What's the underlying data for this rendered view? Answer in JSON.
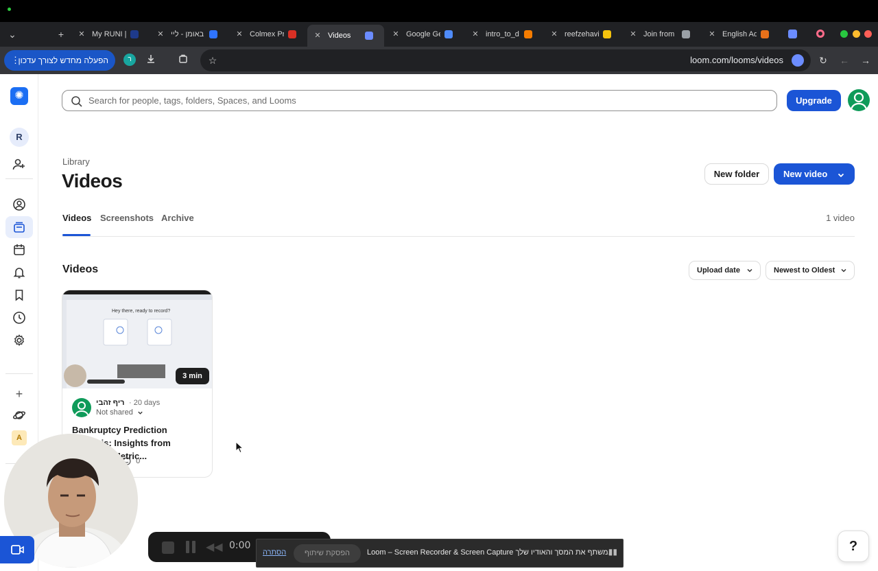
{
  "browser": {
    "tabs": [
      {
        "label": "My RUNI |",
        "fav_color": "#1e3a8a"
      },
      {
        "label": "באומן - ליי",
        "fav_color": "#2f74ff"
      },
      {
        "label": "Colmex Pr",
        "fav_color": "#d93025"
      },
      {
        "label": "Videos",
        "fav_color": "#6b8cff"
      },
      {
        "label": "Google Ge",
        "fav_color": "#4f8bf9"
      },
      {
        "label": "intro_to_d",
        "fav_color": "#f57c00"
      },
      {
        "label": "reefzehavi",
        "fav_color": "#f4c20d"
      },
      {
        "label": "Join from",
        "fav_color": "#9aa0a6"
      },
      {
        "label": "English Ad",
        "fav_color": "#e8711a"
      }
    ],
    "update_button": "הפעלה מחדש לצורך עדכון",
    "update_avatar": "ר",
    "url": "loom.com/looms/videos"
  },
  "sidebar": {
    "workspace_initial": "R",
    "workspace_alt_initial": "A"
  },
  "header": {
    "search_placeholder": "Search for people, tags, folders, Spaces, and Looms",
    "upgrade_label": "Upgrade"
  },
  "library": {
    "breadcrumb": "Library",
    "title": "Videos",
    "new_folder_label": "New folder",
    "new_video_label": "New video",
    "tabs": [
      "Videos",
      "Screenshots",
      "Archive"
    ],
    "video_count": "1 video",
    "section_title": "Videos",
    "sort_field": "Upload date",
    "sort_order": "Newest to Oldest"
  },
  "video_card": {
    "duration": "3 min",
    "author": "ריף זהבי",
    "age": "· 20 days",
    "share_status": "Not shared",
    "title": "Bankruptcy Prediction Analysis: Insights from Financial Metric...",
    "comments": "0",
    "thumb_heading": "Hey there, ready to record?"
  },
  "recorder": {
    "time": "0:00"
  },
  "sharebar": {
    "hide_label": "הסתרה",
    "stop_label": "הפסקת שיתוף",
    "message": "Loom – Screen Recorder & Screen Capture משתף את המסך והאודיו שלך."
  },
  "help_label": "?",
  "colors": {
    "accent": "#1b55d6",
    "avatar_green": "#0f9b5a"
  }
}
